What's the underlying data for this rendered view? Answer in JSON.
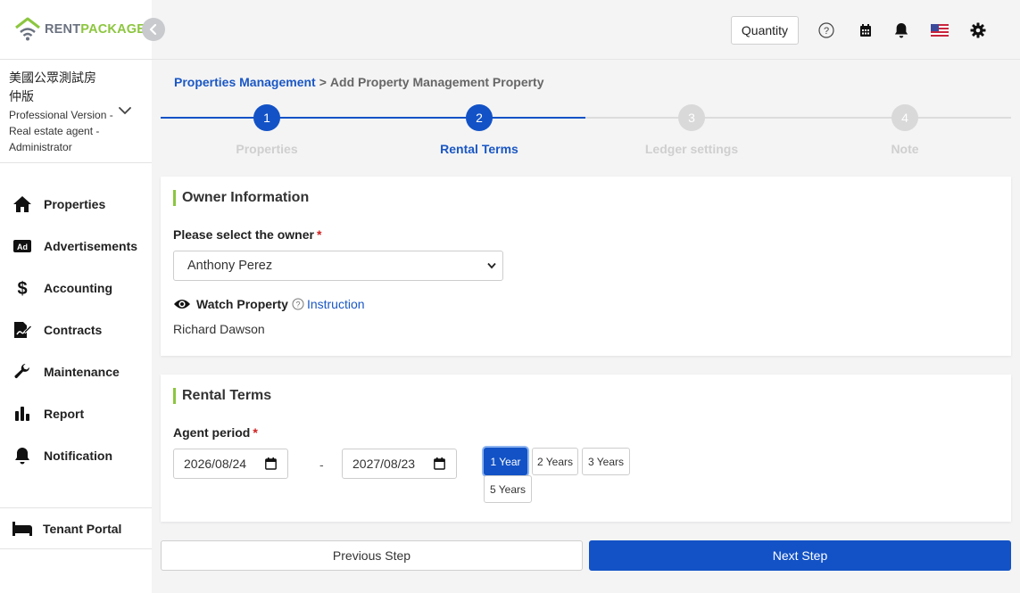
{
  "brand": {
    "rent": "RENT",
    "package": "PACKAGE",
    "accent": "#8cc63f",
    "primary": "#1252c6"
  },
  "account": {
    "name": "美國公眾測試房仲版",
    "role": "Professional Version - Real estate agent - Administrator"
  },
  "sidebar": {
    "items": [
      {
        "label": "Properties",
        "icon": "home-icon"
      },
      {
        "label": "Advertisements",
        "icon": "ad-icon"
      },
      {
        "label": "Accounting",
        "icon": "dollar-icon"
      },
      {
        "label": "Contracts",
        "icon": "contract-icon"
      },
      {
        "label": "Maintenance",
        "icon": "wrench-icon"
      },
      {
        "label": "Report",
        "icon": "bar-chart-icon"
      },
      {
        "label": "Notification",
        "icon": "bell-icon"
      }
    ],
    "tenant_portal": {
      "label": "Tenant Portal",
      "icon": "bed-icon"
    }
  },
  "header": {
    "quantity_label": "Quantity",
    "icons": [
      "help-icon",
      "calendar-icon",
      "bell-icon",
      "us-flag-icon",
      "gear-icon"
    ]
  },
  "breadcrumb": {
    "parent": "Properties Management",
    "separator": ">",
    "current": "Add Property Management Property"
  },
  "stepper": {
    "active_index": 1,
    "steps": [
      {
        "number": "1",
        "label": "Properties"
      },
      {
        "number": "2",
        "label": "Rental Terms"
      },
      {
        "number": "3",
        "label": "Ledger settings"
      },
      {
        "number": "4",
        "label": "Note"
      }
    ]
  },
  "owner_info": {
    "title": "Owner Information",
    "select_label": "Please select the owner",
    "required_mark": "*",
    "selected_owner": "Anthony Perez",
    "watch_label": "Watch Property",
    "instruction_link": "Instruction",
    "watcher_name": "Richard Dawson"
  },
  "rental_terms": {
    "title": "Rental Terms",
    "agent_period_label": "Agent period",
    "required_mark": "*",
    "start_date": "2026/08/24",
    "end_date": "2027/08/23",
    "separator": "-",
    "period_options": [
      "1 Year",
      "2 Years",
      "3 Years",
      "5 Years"
    ],
    "selected_period": "1 Year"
  },
  "footer": {
    "prev_label": "Previous Step",
    "next_label": "Next Step"
  }
}
